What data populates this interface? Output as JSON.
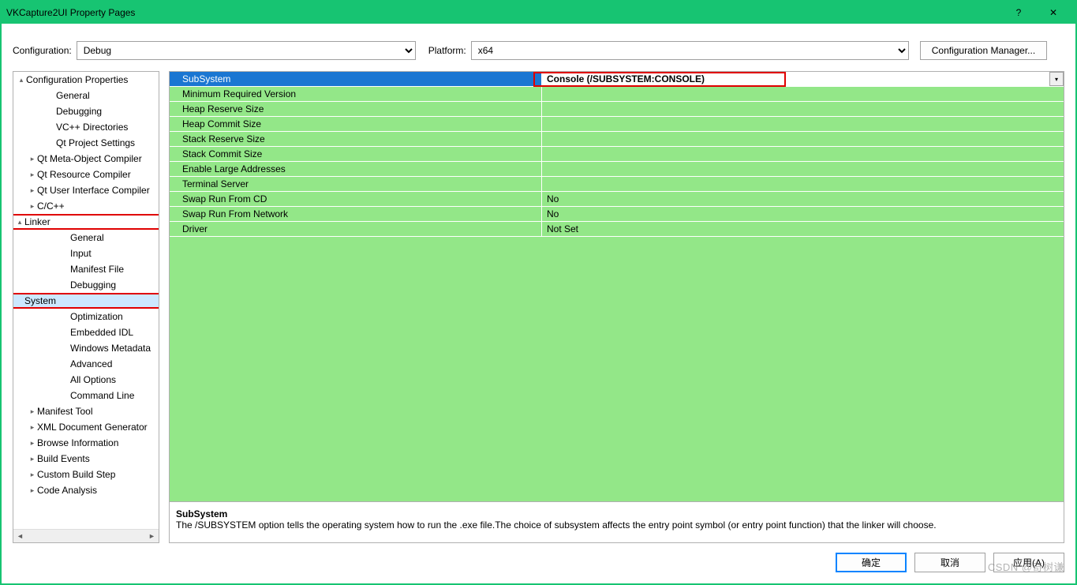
{
  "window": {
    "title": "VKCapture2UI Property Pages",
    "help_icon": "?",
    "close_icon": "✕"
  },
  "config_bar": {
    "config_label": "Configuration:",
    "config_value": "Debug",
    "platform_label": "Platform:",
    "platform_value": "x64",
    "manager_button": "Configuration Manager..."
  },
  "tree": [
    {
      "indent": 0,
      "arrow": "▴",
      "label": "Configuration Properties"
    },
    {
      "indent": 2,
      "arrow": "",
      "label": "General"
    },
    {
      "indent": 2,
      "arrow": "",
      "label": "Debugging"
    },
    {
      "indent": 2,
      "arrow": "",
      "label": "VC++ Directories"
    },
    {
      "indent": 2,
      "arrow": "",
      "label": "Qt Project Settings"
    },
    {
      "indent": 1,
      "arrow": "▸",
      "label": "Qt Meta-Object Compiler"
    },
    {
      "indent": 1,
      "arrow": "▸",
      "label": "Qt Resource Compiler"
    },
    {
      "indent": 1,
      "arrow": "▸",
      "label": "Qt User Interface Compiler"
    },
    {
      "indent": 1,
      "arrow": "▸",
      "label": "C/C++"
    },
    {
      "indent": 1,
      "arrow": "▴",
      "label": "Linker",
      "red": true
    },
    {
      "indent": 3,
      "arrow": "",
      "label": "General"
    },
    {
      "indent": 3,
      "arrow": "",
      "label": "Input"
    },
    {
      "indent": 3,
      "arrow": "",
      "label": "Manifest File"
    },
    {
      "indent": 3,
      "arrow": "",
      "label": "Debugging"
    },
    {
      "indent": 3,
      "arrow": "",
      "label": "System",
      "selected": true,
      "red": true
    },
    {
      "indent": 3,
      "arrow": "",
      "label": "Optimization"
    },
    {
      "indent": 3,
      "arrow": "",
      "label": "Embedded IDL"
    },
    {
      "indent": 3,
      "arrow": "",
      "label": "Windows Metadata"
    },
    {
      "indent": 3,
      "arrow": "",
      "label": "Advanced"
    },
    {
      "indent": 3,
      "arrow": "",
      "label": "All Options"
    },
    {
      "indent": 3,
      "arrow": "",
      "label": "Command Line"
    },
    {
      "indent": 1,
      "arrow": "▸",
      "label": "Manifest Tool"
    },
    {
      "indent": 1,
      "arrow": "▸",
      "label": "XML Document Generator"
    },
    {
      "indent": 1,
      "arrow": "▸",
      "label": "Browse Information"
    },
    {
      "indent": 1,
      "arrow": "▸",
      "label": "Build Events"
    },
    {
      "indent": 1,
      "arrow": "▸",
      "label": "Custom Build Step"
    },
    {
      "indent": 1,
      "arrow": "▸",
      "label": "Code Analysis"
    }
  ],
  "grid": [
    {
      "name": "SubSystem",
      "value": "Console (/SUBSYSTEM:CONSOLE)",
      "selected": true,
      "red_value": true
    },
    {
      "name": "Minimum Required Version",
      "value": ""
    },
    {
      "name": "Heap Reserve Size",
      "value": ""
    },
    {
      "name": "Heap Commit Size",
      "value": ""
    },
    {
      "name": "Stack Reserve Size",
      "value": ""
    },
    {
      "name": "Stack Commit Size",
      "value": ""
    },
    {
      "name": "Enable Large Addresses",
      "value": ""
    },
    {
      "name": "Terminal Server",
      "value": ""
    },
    {
      "name": "Swap Run From CD",
      "value": "No"
    },
    {
      "name": "Swap Run From Network",
      "value": "No"
    },
    {
      "name": "Driver",
      "value": "Not Set"
    }
  ],
  "description": {
    "title": "SubSystem",
    "text": "The /SUBSYSTEM option tells the operating system how to run the .exe file.The choice of subsystem affects the entry point symbol (or entry point function) that the linker will choose."
  },
  "buttons": {
    "ok": "确定",
    "cancel": "取消",
    "apply": "应用(A)"
  },
  "watermark": "CSDN @奇树谦"
}
